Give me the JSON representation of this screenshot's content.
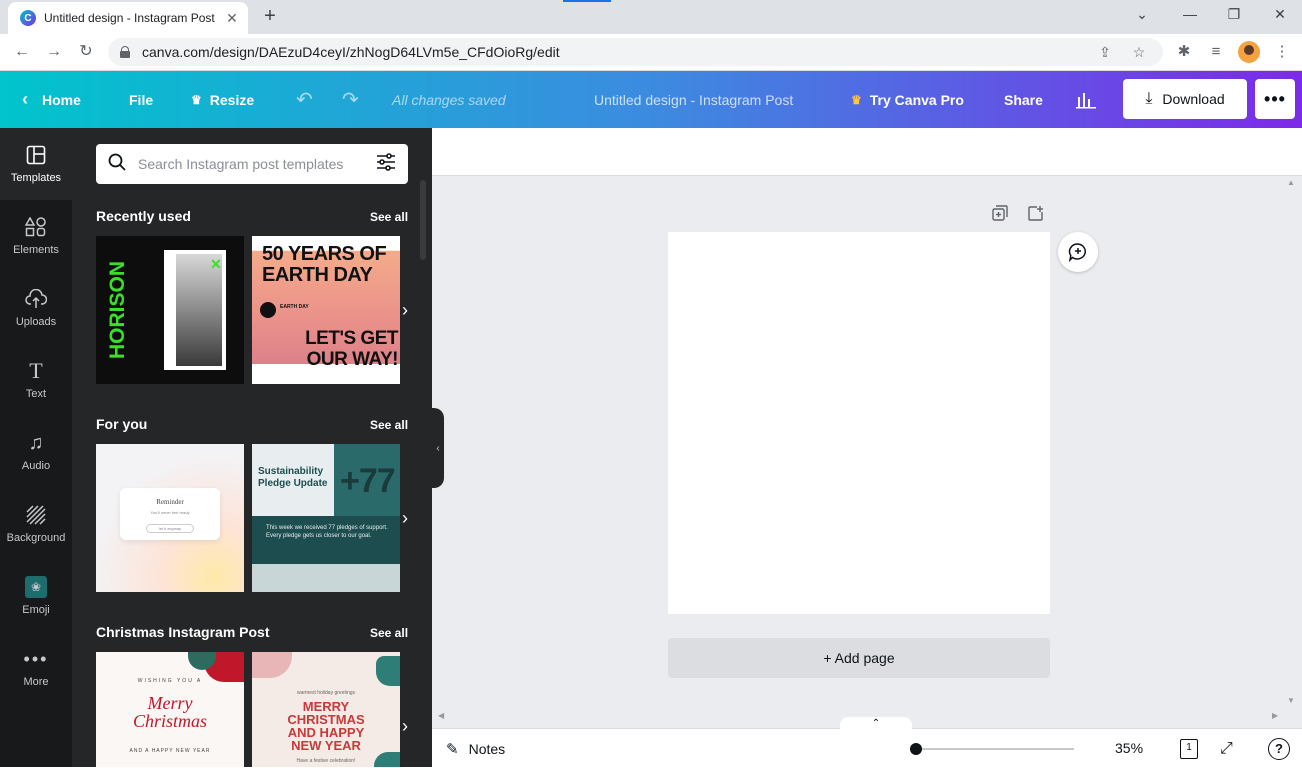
{
  "browser": {
    "tab_title": "Untitled design - Instagram Post",
    "favicon_letter": "C",
    "close_glyph": "✕",
    "new_tab_glyph": "+",
    "url": "canva.com/design/DAEzuD4ceyI/zhNogD64LVm5e_CFdOioRg/edit",
    "window_controls": [
      "⌄",
      "—",
      "❐",
      "✕"
    ]
  },
  "topbar": {
    "home": "Home",
    "file": "File",
    "resize": "Resize",
    "status": "All changes saved",
    "doc_title": "Untitled design - Instagram Post",
    "try_pro": "Try Canva Pro",
    "share": "Share",
    "download": "Download",
    "more": "•••"
  },
  "rail": {
    "items": [
      {
        "label": "Templates",
        "icon": "templates-icon"
      },
      {
        "label": "Elements",
        "icon": "elements-icon"
      },
      {
        "label": "Uploads",
        "icon": "uploads-icon"
      },
      {
        "label": "Text",
        "icon": "text-icon"
      },
      {
        "label": "Audio",
        "icon": "audio-icon"
      },
      {
        "label": "Background",
        "icon": "background-icon"
      },
      {
        "label": "Emoji",
        "icon": "emoji-icon"
      },
      {
        "label": "More",
        "icon": "more-icon"
      }
    ]
  },
  "panel": {
    "search_placeholder": "Search Instagram post templates",
    "sections": [
      {
        "title": "Recently used",
        "see_all": "See all"
      },
      {
        "title": "For you",
        "see_all": "See all"
      },
      {
        "title": "Christmas Instagram Post",
        "see_all": "See all"
      }
    ],
    "thumbs": {
      "horison": "HORISON",
      "earth_top": "50 YEARS OF EARTH DAY",
      "earth_small": "EARTH DAY",
      "earth_bottom": "LET'S GET OUR WAY!",
      "reminder_title": "Reminder",
      "reminder_body": "You'll never feel ready",
      "reminder_tag": "let it anyway",
      "sustain_title": "Sustainability Pledge Update",
      "sustain_num": "+77",
      "sustain_body": "This week we received 77 pledges of support. Every pledge gets us closer to our goal.",
      "merry_top": "WISHING YOU A",
      "merry_script": "Merry Christmas",
      "merry_bottom": "AND A HAPPY NEW YEAR",
      "xmas_top": "warmest holiday greetings",
      "xmas_main": "MERRY CHRISTMAS AND HAPPY NEW YEAR",
      "xmas_bottom": "Have a festive celebration!"
    }
  },
  "workspace": {
    "add_page": "+ Add page"
  },
  "bottombar": {
    "notes": "Notes",
    "zoom": "35%",
    "zoom_fraction": 0.35,
    "page_count": "1",
    "help": "?"
  },
  "colors": {
    "gradient_start": "#00c4cc",
    "gradient_end": "#7d2ae8",
    "rail_bg": "#18191b",
    "panel_bg": "#252627",
    "workspace_bg": "#ebecf0"
  }
}
